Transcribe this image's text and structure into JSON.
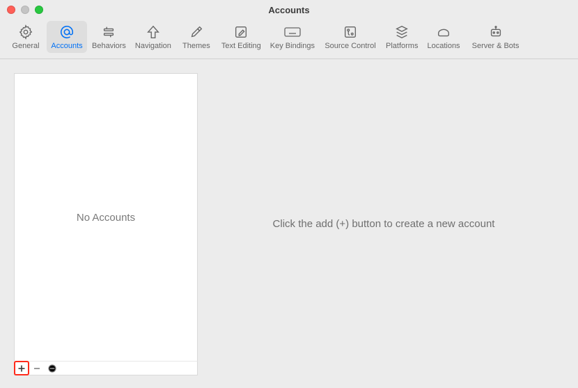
{
  "window": {
    "title": "Accounts"
  },
  "toolbar": {
    "items": [
      {
        "label": "General"
      },
      {
        "label": "Accounts"
      },
      {
        "label": "Behaviors"
      },
      {
        "label": "Navigation"
      },
      {
        "label": "Themes"
      },
      {
        "label": "Text Editing"
      },
      {
        "label": "Key Bindings"
      },
      {
        "label": "Source Control"
      },
      {
        "label": "Platforms"
      },
      {
        "label": "Locations"
      },
      {
        "label": "Server & Bots"
      }
    ],
    "selected_index": 1
  },
  "sidebar": {
    "empty_label": "No Accounts"
  },
  "detail": {
    "placeholder": "Click the add (+) button to create a new account"
  }
}
